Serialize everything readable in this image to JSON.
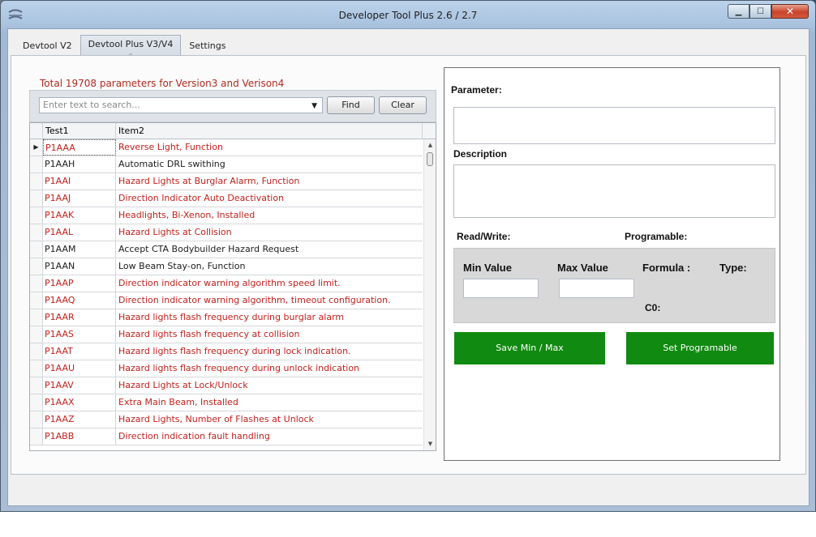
{
  "window": {
    "title": "Developer Tool Plus 2.6 / 2.7",
    "controls": {
      "minimize": "▁",
      "maximize": "☐",
      "close": "✕"
    }
  },
  "tabs": [
    {
      "label": "Devtool V2"
    },
    {
      "label": "Devtool Plus V3/V4"
    },
    {
      "label": "Settings"
    }
  ],
  "left": {
    "total_label": "Total 19708 parameters for Version3 and Verison4",
    "search": {
      "placeholder": "Enter text to search...",
      "dropdown_glyph": "▼"
    },
    "find_label": "Find",
    "clear_label": "Clear",
    "columns": [
      "Test1",
      "Item2"
    ],
    "rows": [
      {
        "code": "P1AAA",
        "item": "Reverse Light, Function",
        "color": "red",
        "selected": true
      },
      {
        "code": "P1AAH",
        "item": "Automatic DRL swithing",
        "color": "black"
      },
      {
        "code": "P1AAI",
        "item": "Hazard Lights at Burglar Alarm, Function",
        "color": "red"
      },
      {
        "code": "P1AAJ",
        "item": "Direction Indicator Auto Deactivation",
        "color": "red"
      },
      {
        "code": "P1AAK",
        "item": "Headlights, Bi-Xenon, Installed",
        "color": "red"
      },
      {
        "code": "P1AAL",
        "item": "Hazard Lights at Collision",
        "color": "red"
      },
      {
        "code": "P1AAM",
        "item": "Accept CTA Bodybuilder Hazard Request",
        "color": "black"
      },
      {
        "code": "P1AAN",
        "item": "Low Beam Stay-on, Function",
        "color": "black"
      },
      {
        "code": "P1AAP",
        "item": "Direction indicator warning algorithm speed limit.",
        "color": "red"
      },
      {
        "code": "P1AAQ",
        "item": "Direction indicator warning algorithm, timeout configuration.",
        "color": "red"
      },
      {
        "code": "P1AAR",
        "item": "Hazard lights flash frequency during burglar alarm",
        "color": "red"
      },
      {
        "code": "P1AAS",
        "item": "Hazard lights flash frequency at collision",
        "color": "red"
      },
      {
        "code": "P1AAT",
        "item": "Hazard lights flash frequency during lock indication.",
        "color": "red"
      },
      {
        "code": "P1AAU",
        "item": "Hazard lights flash frequency during unlock indication",
        "color": "red"
      },
      {
        "code": "P1AAV",
        "item": "Hazard Lights at Lock/Unlock",
        "color": "red"
      },
      {
        "code": "P1AAX",
        "item": "Extra Main Beam, Installed",
        "color": "red"
      },
      {
        "code": "P1AAZ",
        "item": "Hazard Lights, Number of Flashes at Unlock",
        "color": "red"
      },
      {
        "code": "P1ABB",
        "item": "Direction indication fault handling",
        "color": "red"
      }
    ]
  },
  "right": {
    "parameter_label": "Parameter:",
    "description_label": "Description",
    "readwrite_label": "Read/Write:",
    "programable_label": "Programable:",
    "min_label": "Min Value",
    "max_label": "Max Value",
    "formula_label": "Formula :",
    "type_label": "Type:",
    "c0_label": "C0:",
    "save_button_label": "Save Min / Max",
    "set_programable_label": "Set Programable"
  },
  "colors": {
    "red_text": "#c41f1a",
    "green_button": "#108a10",
    "accent_title": "#b32a20"
  }
}
